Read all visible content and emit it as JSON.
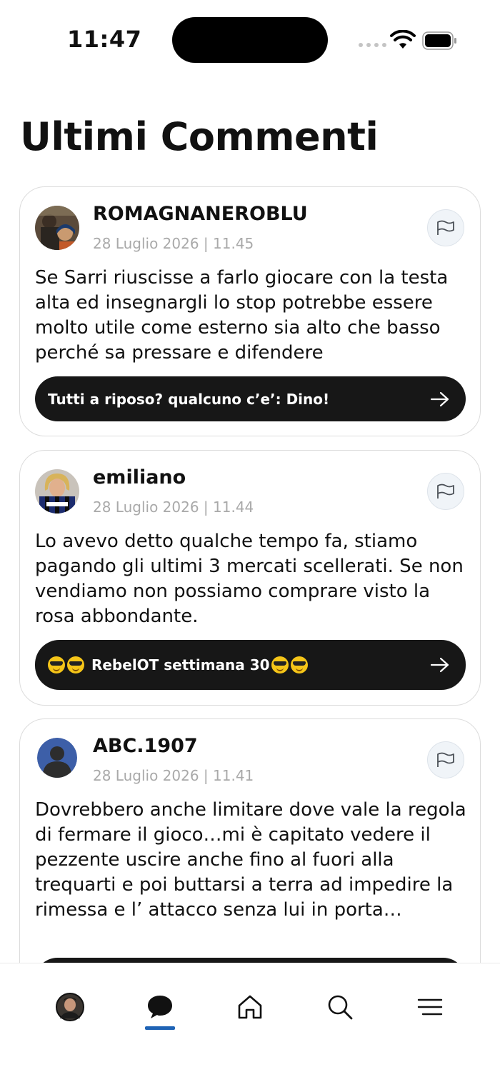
{
  "status_bar": {
    "time": "11:47"
  },
  "page_title": "Ultimi Commenti",
  "comments": [
    {
      "username": "ROMAGNANEROBLU",
      "timestamp": "28 Luglio 2026 | 11.45",
      "text": "Se Sarri riuscisse a farlo giocare con la testa alta ed insegnargli lo stop potrebbe essere molto utile come esterno sia alto che basso perché sa pressare e difendere",
      "reply_title": "Tutti a riposo? qualcuno c’e’: Dino!"
    },
    {
      "username": "emiliano",
      "timestamp": "28 Luglio 2026 | 11.44",
      "text": "Lo avevo detto qualche tempo fa, stiamo pagando gli ultimi 3 mercati scellerati. Se non vendiamo non possiamo comprare visto la rosa abbondante.",
      "reply_title": "RebelOT settimana 30"
    },
    {
      "username": "ABC.1907",
      "timestamp": "28 Luglio 2026 | 11.41",
      "text": "Dovrebbero anche limitare dove vale la regola di fermare il gioco…mi è capitato vedere il pezzente uscire anche fino al fuori alla trequarti e poi buttarsi a terra ad impedire la rimessa e l’ attacco senza lui in porta…"
    }
  ],
  "tab_bar": {
    "items": [
      "profile-avatar",
      "comments-icon",
      "home-icon",
      "search-icon",
      "menu-icon"
    ],
    "active": "comments-icon",
    "accent_color": "#1e63b5"
  }
}
